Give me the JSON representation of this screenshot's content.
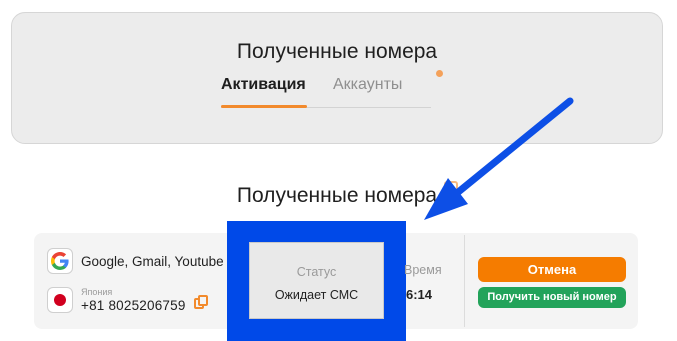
{
  "top_card": {
    "title": "Полученные номера",
    "tabs": [
      {
        "label": "Активация",
        "active": true
      },
      {
        "label": "Аккаунты",
        "active": false
      }
    ]
  },
  "main_card": {
    "title": "Полученные номера",
    "row": {
      "service": {
        "name": "Google, Gmail, Youtube",
        "icon": "google-icon"
      },
      "country": {
        "name": "Япония",
        "icon": "japan-flag-icon"
      },
      "phone": {
        "code": "+81",
        "number": "8025206759"
      },
      "status": {
        "label": "Статус",
        "value": "Ожидает СМС"
      },
      "time": {
        "label": "Время",
        "value": "6:14"
      },
      "buttons": {
        "cancel": "Отмена",
        "new_number": "Получить новый номер"
      }
    }
  },
  "colors": {
    "accent": "#f28a2c",
    "cancel_button": "#f57c00",
    "new_number_button": "#22a35a",
    "highlight": "#0049e8"
  }
}
